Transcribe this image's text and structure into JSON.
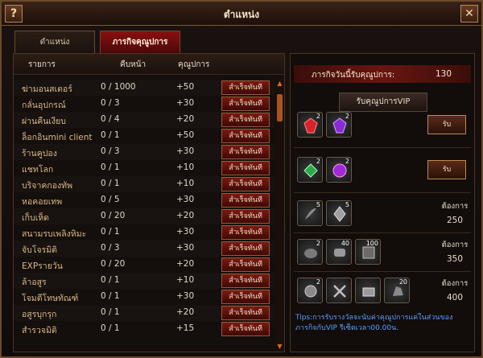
{
  "window": {
    "title": "ตำแหน่ง",
    "help_label": "?",
    "close_label": "✕"
  },
  "tabs": [
    {
      "label": "ตำแหน่ง",
      "active": false
    },
    {
      "label": "ภารกิจคุณูปการ",
      "active": true
    }
  ],
  "task_table": {
    "columns": [
      "รายการ",
      "คืบหน้า",
      "คุณูปการ"
    ],
    "rows": [
      {
        "name": "ฆ่ามอนสเตอร์",
        "progress": "0 / 1000",
        "points": "+50",
        "action": "สำเร็จทันที"
      },
      {
        "name": "กลั่นอุปกรณ์",
        "progress": "0 / 3",
        "points": "+30",
        "action": "สำเร็จทันที"
      },
      {
        "name": "ผ่านคืนเงียบ",
        "progress": "0 / 4",
        "points": "+20",
        "action": "สำเร็จทันที"
      },
      {
        "name": "ล็อกอินmini client",
        "progress": "0 / 1",
        "points": "+50",
        "action": "สำเร็จทันที"
      },
      {
        "name": "ร้านคูปอง",
        "progress": "0 / 3",
        "points": "+30",
        "action": "สำเร็จทันที"
      },
      {
        "name": "แชทโลก",
        "progress": "0 / 1",
        "points": "+10",
        "action": "สำเร็จทันที"
      },
      {
        "name": "บริจาคกองทัพ",
        "progress": "0 / 1",
        "points": "+10",
        "action": "สำเร็จทันที"
      },
      {
        "name": "หอคอยเทพ",
        "progress": "0 / 5",
        "points": "+30",
        "action": "สำเร็จทันที"
      },
      {
        "name": "เก็บเห็ด",
        "progress": "0 / 20",
        "points": "+20",
        "action": "สำเร็จทันที"
      },
      {
        "name": "สนามรบเพลิงหิมะ",
        "progress": "0 / 1",
        "points": "+30",
        "action": "สำเร็จทันที"
      },
      {
        "name": "จับโจรมิติ",
        "progress": "0 / 3",
        "points": "+30",
        "action": "สำเร็จทันที"
      },
      {
        "name": "EXPรายวัน",
        "progress": "0 / 20",
        "points": "+20",
        "action": "สำเร็จทันที"
      },
      {
        "name": "ล้าอสูร",
        "progress": "0 / 1",
        "points": "+10",
        "action": "สำเร็จทันที"
      },
      {
        "name": "โจมตีโทษทัณฑ์",
        "progress": "0 / 1",
        "points": "+30",
        "action": "สำเร็จทันที"
      },
      {
        "name": "อสูรบุกรุก",
        "progress": "0 / 1",
        "points": "+20",
        "action": "สำเร็จทันที"
      },
      {
        "name": "สำรวจมิติ",
        "progress": "0 / 1",
        "points": "+15",
        "action": "สำเร็จทันที"
      }
    ]
  },
  "reward_panel": {
    "daily_label": "ภารกิจวันนี้รับคุณูปการ:",
    "daily_value": "130",
    "vip_button": "รับคุณูปการVIP",
    "rows": [
      {
        "items": [
          {
            "icon": "red-gem-icon",
            "count": "2"
          },
          {
            "icon": "purple-gem-icon",
            "count": "2"
          }
        ],
        "claim_label": "รับ"
      },
      {
        "items": [
          {
            "icon": "green-gem-icon",
            "count": "2"
          },
          {
            "icon": "violet-orb-icon",
            "count": "2"
          }
        ],
        "claim_label": "รับ"
      },
      {
        "items": [
          {
            "icon": "grey-feather-icon",
            "count": "5"
          },
          {
            "icon": "grey-crystal-icon",
            "count": "5"
          }
        ],
        "req_label": "ต้องการ",
        "req_value": "250"
      },
      {
        "items": [
          {
            "icon": "grey-stone-icon",
            "count": "2"
          },
          {
            "icon": "grey-scroll-icon",
            "count": "40"
          },
          {
            "icon": "grey-rune-icon",
            "count": "100"
          }
        ],
        "req_label": "ต้องการ",
        "req_value": "350"
      },
      {
        "items": [
          {
            "icon": "grey-medal-icon",
            "count": "2"
          },
          {
            "icon": "grey-swords-icon",
            "count": ""
          },
          {
            "icon": "grey-chest-icon",
            "count": ""
          },
          {
            "icon": "grey-ore-icon",
            "count": "20"
          }
        ],
        "req_label": "ต้องการ",
        "req_value": "400"
      }
    ],
    "tips": "Tips:การรับรางวัลจะนับค่าคุณูปการแค่ในส่วนของภารกิจกับVIP  รีเซ็ตเวลา00.00น."
  },
  "colors": {
    "accent_red": "#8a1010",
    "border_gold": "#6b4a2a",
    "name_text": "#d9b98a",
    "tips_text": "#5aa0ff"
  }
}
